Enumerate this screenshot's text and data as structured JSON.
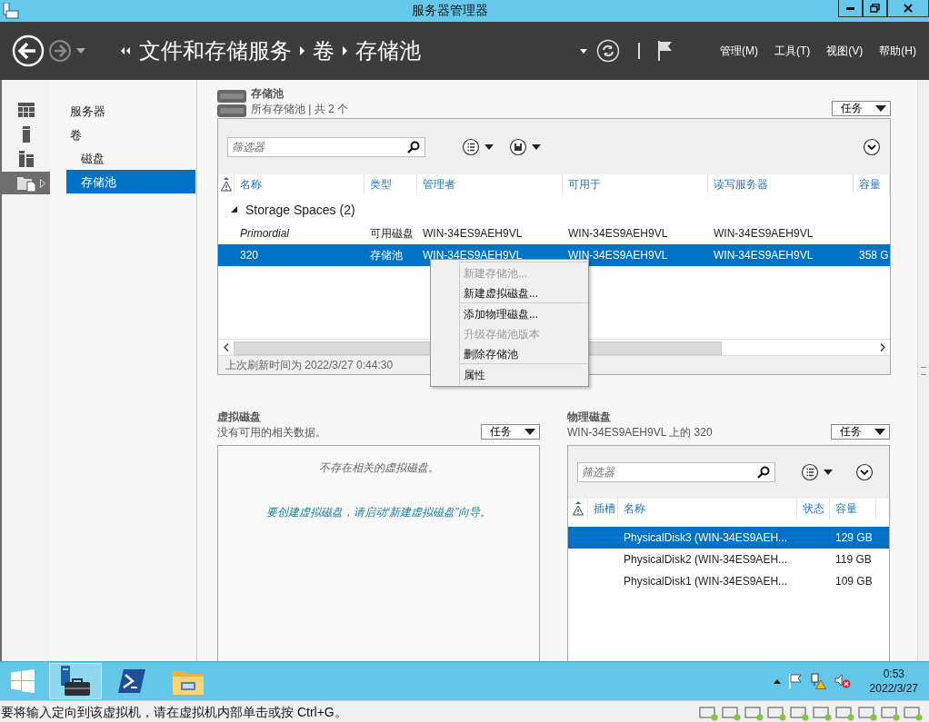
{
  "window": {
    "title": "服务器管理器"
  },
  "header": {
    "breadcrumb": [
      "文件和存储服务",
      "卷",
      "存储池"
    ],
    "menus": [
      "管理(M)",
      "工具(T)",
      "视图(V)",
      "帮助(H)"
    ]
  },
  "side_icons": [
    {
      "kind": "dashboard",
      "selected": false
    },
    {
      "kind": "server",
      "selected": false
    },
    {
      "kind": "servers",
      "selected": false
    },
    {
      "kind": "files",
      "selected": true
    }
  ],
  "nav": [
    {
      "label": "服务器",
      "selected": false
    },
    {
      "label": "卷",
      "selected": false,
      "children": [
        {
          "label": "磁盘",
          "selected": false
        },
        {
          "label": "存储池",
          "selected": true
        }
      ]
    }
  ],
  "storage_pools": {
    "title": "存储池",
    "subtitle": "所有存储池 | 共 2 个",
    "tasks_button": "任务",
    "filter_placeholder": "筛选器",
    "columns": [
      "名称",
      "类型",
      "管理者",
      "可用于",
      "读写服务器",
      "容量"
    ],
    "groups": [
      {
        "label": "Storage Spaces (2)",
        "expanded": true,
        "rows": [
          {
            "cells": [
              "Primordial",
              "可用磁盘",
              "WIN-34ES9AEH9VL",
              "WIN-34ES9AEH9VL",
              "WIN-34ES9AEH9VL"
            ],
            "primordial": true,
            "selected": false
          },
          {
            "cells": [
              "320",
              "存储池",
              "WIN-34ES9AEH9VL",
              "WIN-34ES9AEH9VL",
              "WIN-34ES9AEH9VL",
              "358 G"
            ],
            "primordial": false,
            "selected": true
          }
        ]
      }
    ],
    "refreshed": "上次刷新时间为 2022/3/27 0:44:30"
  },
  "context_menu": {
    "sections": [
      [
        {
          "label": "新建存储池...",
          "disabled": true
        },
        {
          "label": "新建虚拟磁盘...",
          "disabled": false
        }
      ],
      [
        {
          "label": "添加物理磁盘...",
          "disabled": false
        },
        {
          "label": "升级存储池版本",
          "disabled": true
        },
        {
          "label": "删除存储池",
          "disabled": false
        }
      ],
      [
        {
          "label": "属性",
          "disabled": false
        }
      ]
    ]
  },
  "virtual_disks": {
    "title": "虚拟磁盘",
    "subtitle": "没有可用的相关数据。",
    "tasks_button": "任务",
    "empty_message": "不存在相关的虚拟磁盘。",
    "hint": "要创建虚拟磁盘，请启动“新建虚拟磁盘”向导。"
  },
  "physical_disks": {
    "title": "物理磁盘",
    "subtitle": "WIN-34ES9AEH9VL 上的 320",
    "tasks_button": "任务",
    "filter_placeholder": "筛选器",
    "columns": [
      "插槽",
      "名称",
      "状态",
      "容量"
    ],
    "rows": [
      {
        "name": "PhysicalDisk3 (WIN-34ES9AEH...",
        "capacity": "129 GB",
        "selected": true
      },
      {
        "name": "PhysicalDisk2 (WIN-34ES9AEH...",
        "capacity": "119 GB",
        "selected": false
      },
      {
        "name": "PhysicalDisk1 (WIN-34ES9AEH...",
        "capacity": "109 GB",
        "selected": false
      }
    ]
  },
  "taskbar": {
    "apps": [
      {
        "kind": "server-manager",
        "selected": true
      },
      {
        "kind": "powershell",
        "selected": false
      },
      {
        "kind": "explorer",
        "selected": false
      }
    ],
    "time": "0:53",
    "date": "2022/3/27"
  },
  "status_bar": {
    "text": "要将输入定向到该虚拟机，请在虚拟机内部单击或按 Ctrl+G。"
  }
}
